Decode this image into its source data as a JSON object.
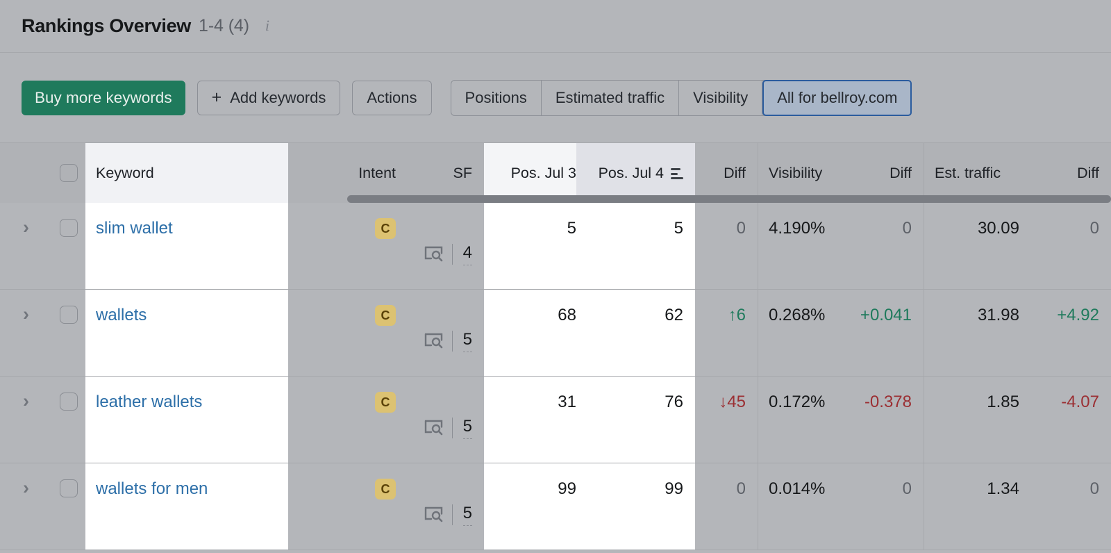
{
  "header": {
    "title": "Rankings Overview",
    "count": "1-4 (4)",
    "info_icon": "info-icon"
  },
  "toolbar": {
    "buy_label": "Buy more keywords",
    "add_label": "Add keywords",
    "add_icon": "plus-icon",
    "actions_label": "Actions",
    "segments": [
      {
        "label": "Positions",
        "active": false
      },
      {
        "label": "Estimated traffic",
        "active": false
      },
      {
        "label": "Visibility",
        "active": false
      },
      {
        "label": "All for bellroy.com",
        "active": true
      }
    ]
  },
  "table": {
    "columns": {
      "keyword": "Keyword",
      "intent": "Intent",
      "sf": "SF",
      "pos1": "Pos. Jul 3",
      "pos2": "Pos. Jul 4",
      "diff1": "Diff",
      "visibility": "Visibility",
      "diff2": "Diff",
      "est_traffic": "Est. traffic",
      "diff3": "Diff"
    },
    "sort": {
      "column": "Pos. Jul 4",
      "icon": "sort-icon"
    },
    "rows": [
      {
        "expand_icon": "chevron-right-icon",
        "keyword": "slim wallet",
        "intent": "C",
        "serp_icon": "serp-feature-icon",
        "sf": "4",
        "pos1": "5",
        "pos2": "5",
        "diff1": "0",
        "diff1_dir": "zero",
        "visibility": "4.190%",
        "diff2": "0",
        "diff2_dir": "zero",
        "est_traffic": "30.09",
        "diff3": "0",
        "diff3_dir": "zero"
      },
      {
        "expand_icon": "chevron-right-icon",
        "keyword": "wallets",
        "intent": "C",
        "serp_icon": "serp-feature-icon",
        "sf": "5",
        "pos1": "68",
        "pos2": "62",
        "diff1": "↑6",
        "diff1_dir": "pos",
        "visibility": "0.268%",
        "diff2": "+0.041",
        "diff2_dir": "pos",
        "est_traffic": "31.98",
        "diff3": "+4.92",
        "diff3_dir": "pos"
      },
      {
        "expand_icon": "chevron-right-icon",
        "keyword": "leather wallets",
        "intent": "C",
        "serp_icon": "serp-feature-icon",
        "sf": "5",
        "pos1": "31",
        "pos2": "76",
        "diff1": "↓45",
        "diff1_dir": "neg",
        "visibility": "0.172%",
        "diff2": "-0.378",
        "diff2_dir": "neg",
        "est_traffic": "1.85",
        "diff3": "-4.07",
        "diff3_dir": "neg"
      },
      {
        "expand_icon": "chevron-right-icon",
        "keyword": "wallets for men",
        "intent": "C",
        "serp_icon": "serp-feature-icon",
        "sf": "5",
        "pos1": "99",
        "pos2": "99",
        "diff1": "0",
        "diff1_dir": "zero",
        "visibility": "0.014%",
        "diff2": "0",
        "diff2_dir": "zero",
        "est_traffic": "1.34",
        "diff3": "0",
        "diff3_dir": "zero"
      }
    ]
  },
  "colors": {
    "primary_green": "#1f7a5c",
    "positive": "#1f7a5c",
    "negative": "#9b2f33",
    "link": "#2d6fa8",
    "intent_badge_bg": "#dcc272",
    "active_segment_bg": "#a9b6c8",
    "active_segment_border": "#2b5c9e"
  }
}
